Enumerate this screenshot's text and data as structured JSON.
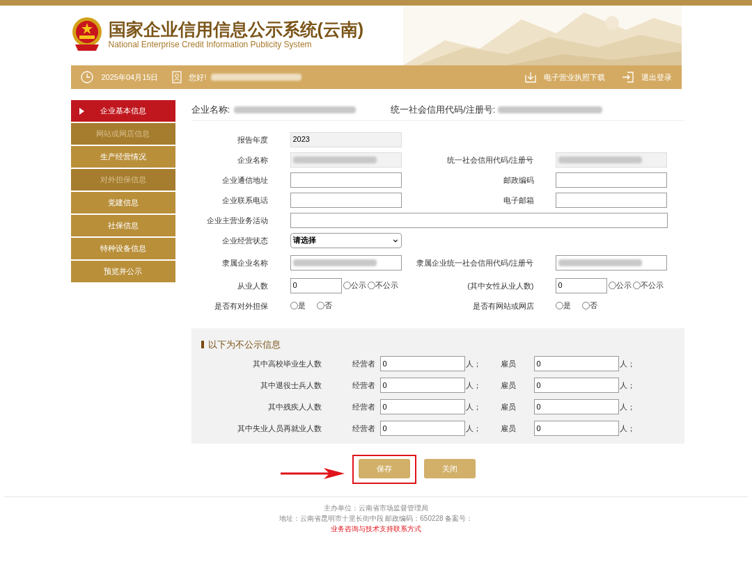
{
  "header": {
    "title": "国家企业信用信息公示系统(云南)",
    "subtitle": "National Enterprise Credit Information Publicity System"
  },
  "toolbar": {
    "date": "2025年04月15日",
    "greeting": "您好!",
    "user_redacted": true,
    "actions": [
      {
        "kind": "download",
        "label": "电子营业执照下载"
      },
      {
        "kind": "logout",
        "label": "退出登录"
      }
    ]
  },
  "sidebar": {
    "items": [
      {
        "label": "企业基本信息",
        "selected": true,
        "disabled": false
      },
      {
        "label": "网站或网店信息",
        "selected": false,
        "disabled": true
      },
      {
        "label": "生产经营情况",
        "selected": false,
        "disabled": false
      },
      {
        "label": "对外担保信息",
        "selected": false,
        "disabled": true
      },
      {
        "label": "党建信息",
        "selected": false,
        "disabled": false
      },
      {
        "label": "社保信息",
        "selected": false,
        "disabled": false
      },
      {
        "label": "特种设备信息",
        "selected": false,
        "disabled": false
      },
      {
        "label": "预览并公示",
        "selected": false,
        "disabled": false
      }
    ]
  },
  "summary": [
    {
      "label": "企业名称:",
      "redacted": true
    },
    {
      "label": "统一社会信用代码/注册号:",
      "redacted": true
    }
  ],
  "form": {
    "rows": [
      [
        {
          "label": "报告年度",
          "kind": "readonly",
          "value": "2023"
        }
      ],
      [
        {
          "label": "企业名称",
          "kind": "readonly",
          "redacted": true
        },
        {
          "label": "统一社会信用代码/注册号",
          "kind": "readonly",
          "redacted": true
        }
      ],
      [
        {
          "label": "企业通信地址",
          "kind": "input"
        },
        {
          "label": "邮政编码",
          "kind": "input"
        }
      ],
      [
        {
          "label": "企业联系电话",
          "kind": "input"
        },
        {
          "label": "电子邮箱",
          "kind": "input"
        }
      ],
      [
        {
          "label": "企业主营业务活动",
          "kind": "wide"
        }
      ],
      [
        {
          "label": "企业经营状态",
          "kind": "select",
          "value": "请选择"
        }
      ],
      [
        {
          "label": "隶属企业名称",
          "kind": "input",
          "redacted": true
        },
        {
          "label": "隶属企业统一社会信用代码/注册号",
          "kind": "input",
          "redacted": true
        }
      ],
      [
        {
          "label": "从业人数",
          "kind": "count",
          "value": "0",
          "options": [
            {
              "label": "公示",
              "selected": false
            },
            {
              "label": "不公示",
              "selected": false
            }
          ]
        },
        {
          "label": "(其中女性从业人数)",
          "kind": "count",
          "value": "0",
          "options": [
            {
              "label": "公示",
              "selected": false
            },
            {
              "label": "不公示",
              "selected": false
            }
          ]
        }
      ],
      [
        {
          "label": "是否有对外担保",
          "kind": "radio",
          "options": [
            {
              "label": "是",
              "selected": false
            },
            {
              "label": "否",
              "selected": false
            }
          ]
        },
        {
          "label": "是否有网站或网店",
          "kind": "radio",
          "options": [
            {
              "label": "是",
              "selected": false
            },
            {
              "label": "否",
              "selected": false
            }
          ]
        }
      ]
    ]
  },
  "private_section": {
    "title": "以下为不公示信息",
    "rows": [
      {
        "label": "其中高校毕业生人数",
        "owner_label": "经营者",
        "owner_value": "0",
        "owner_unit": "人；",
        "employee_label": "雇员",
        "employee_value": "0",
        "employee_unit": "人；"
      },
      {
        "label": "其中退役士兵人数",
        "owner_label": "经营者",
        "owner_value": "0",
        "owner_unit": "人；",
        "employee_label": "雇员",
        "employee_value": "0",
        "employee_unit": "人；"
      },
      {
        "label": "其中残疾人人数",
        "owner_label": "经营者",
        "owner_value": "0",
        "owner_unit": "人；",
        "employee_label": "雇员",
        "employee_value": "0",
        "employee_unit": "人；"
      },
      {
        "label": "其中失业人员再就业人数",
        "owner_label": "经营者",
        "owner_value": "0",
        "owner_unit": "人；",
        "employee_label": "雇员",
        "employee_value": "0",
        "employee_unit": "人；"
      }
    ]
  },
  "buttons": [
    {
      "label": "保存",
      "highlighted": true
    },
    {
      "label": "关闭",
      "highlighted": false
    }
  ],
  "footer": {
    "lines": [
      "主办单位：云南省市场监督管理局",
      "地址：云南省昆明市十里长街中段 邮政编码：650228 备案号："
    ],
    "link": "业务咨询与技术支持联系方式"
  }
}
